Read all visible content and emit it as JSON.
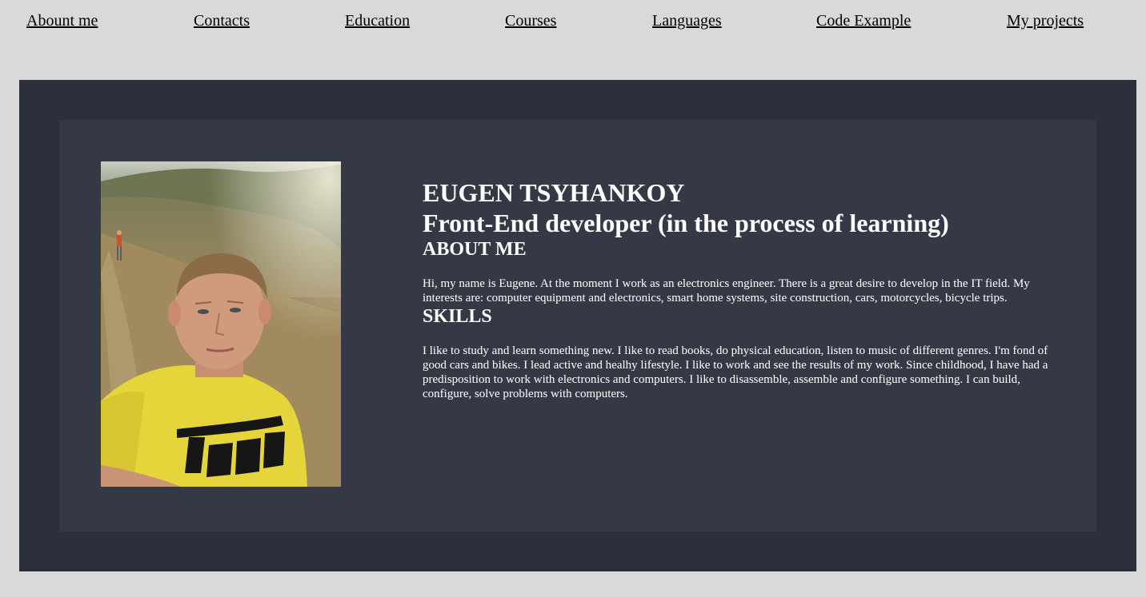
{
  "nav": {
    "items": [
      {
        "label": "Abount me"
      },
      {
        "label": "Contacts"
      },
      {
        "label": "Education"
      },
      {
        "label": "Courses"
      },
      {
        "label": "Languages"
      },
      {
        "label": "Code Example"
      },
      {
        "label": "My projects"
      }
    ]
  },
  "profile": {
    "name": "EUGEN TSYHANKOY",
    "role": "Front-End developer (in the process of learning)",
    "photo_alt": "profile-photo"
  },
  "about": {
    "title": "ABOUT ME",
    "text": "Hi, my name is Eugene. At the moment I work as an electronics engineer. There is a great desire to develop in the IT field. My interests are: computer equipment and electronics, smart home systems, site construction, cars, motorcycles, bicycle trips."
  },
  "skills": {
    "title": "SKILLS",
    "text": "I like to study and learn something new. I like to read books, do physical education, listen to music of different genres. I'm fond of good cars and bikes. I lead active and healhy lifestyle. I like to work and see the results of my work. Since childhood, I have had a predisposition to work with electronics and computers. I like to disassemble, assemble and configure something. I can build, configure, solve problems with computers."
  },
  "colors": {
    "page_bg": "#d9d9d9",
    "outer_bg": "#2b303c",
    "card_bg": "#353946",
    "text": "#ffffff"
  }
}
